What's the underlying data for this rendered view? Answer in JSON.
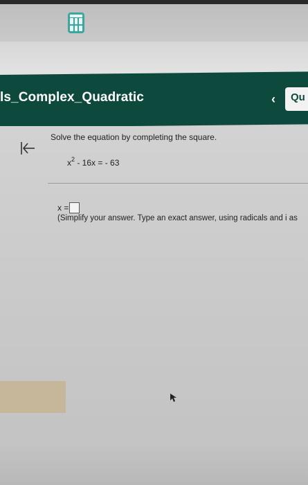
{
  "header": {
    "title": "ls_Complex_Quadratic",
    "next_label": "Qu"
  },
  "problem": {
    "instruction": "Solve the equation by completing the square.",
    "equation_var": "x",
    "equation_exp": "2",
    "equation_rest": " - 16x = - 63",
    "answer_prefix": "x =",
    "hint": "(Simplify your answer. Type an exact answer, using radicals and i as"
  },
  "colors": {
    "header_bg": "#0d4a3d",
    "calculator_icon": "#3ea6a0"
  },
  "icons": {
    "calculator": "calculator-icon",
    "back": "back-to-start-icon",
    "prev": "chevron-left-icon",
    "cursor": "mouse-pointer-icon"
  }
}
